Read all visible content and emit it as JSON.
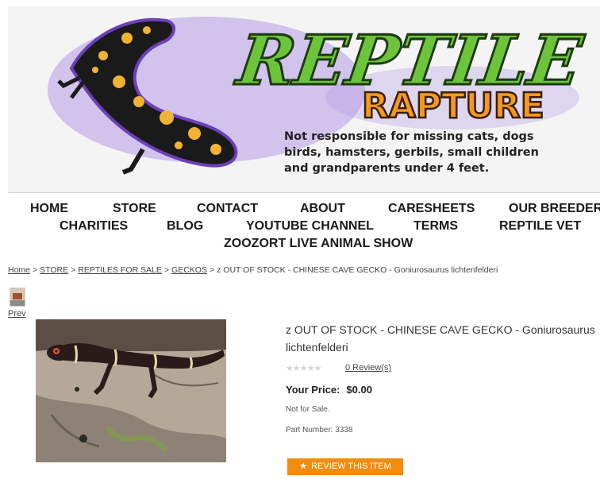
{
  "banner": {
    "logo_line1": "REPTILE",
    "logo_line2": "RAPTURE",
    "tagline": [
      "Not responsible for missing cats, dogs",
      "birds, hamsters, gerbils, small children",
      "and grandparents under 4 feet."
    ]
  },
  "nav": {
    "items": [
      "HOME",
      "STORE",
      "CONTACT",
      "ABOUT",
      "CARESHEETS",
      "OUR BREEDERS",
      "CHARITIES",
      "BLOG",
      "YOUTUBE CHANNEL",
      "TERMS",
      "REPTILE VET",
      "ZOOZORT LIVE ANIMAL SHOW"
    ]
  },
  "breadcrumb": {
    "home": "Home",
    "store": "STORE",
    "reptiles": "REPTILES FOR SALE",
    "geckos": "GECKOS",
    "current": "z OUT OF STOCK - CHINESE CAVE GECKO - Goniurosaurus lichtenfelderi",
    "separator": ">"
  },
  "gallery": {
    "prev_label": "Prev"
  },
  "product": {
    "title": "z OUT OF STOCK - CHINESE CAVE GECKO - Goniurosaurus lichtenfelderi",
    "stars": "★★★★★",
    "rating": 0,
    "reviews_link": "0 Review(s)",
    "price_label": "Your Price:",
    "price_value": "$0.00",
    "availability": "Not for Sale.",
    "part_number": "Part Number: 3338",
    "review_button": "REVIEW THIS ITEM",
    "review_button_icon": "★"
  },
  "colors": {
    "logo_green": "#6cc43a",
    "logo_orange": "#f39a1e",
    "logo_purple_glow": "#8e5fd0",
    "button_orange": "#f28c0f"
  }
}
